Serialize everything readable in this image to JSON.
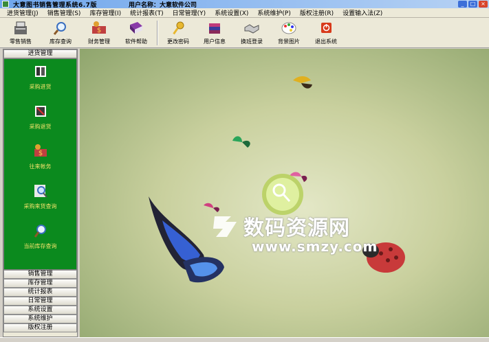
{
  "window": {
    "title": "大意图书销售管理系统6.7版",
    "user_label": "用户名称：大意软件公司",
    "min": "_",
    "max": "□",
    "close": "×"
  },
  "menu": [
    "进货管理(J)",
    "销售管理(S)",
    "库存管理(I)",
    "统计报表(T)",
    "日常管理(Y)",
    "系统设置(X)",
    "系统维护(P)",
    "版权注册(R)",
    "设置输入法(Z)"
  ],
  "toolbar": [
    {
      "label": "零售销售",
      "icon": "cash-register-icon"
    },
    {
      "label": "库存查询",
      "icon": "magnifier-icon"
    },
    {
      "label": "财务管理",
      "icon": "money-icon"
    },
    {
      "label": "软件帮助",
      "icon": "help-book-icon"
    },
    {
      "label": "更改密码",
      "icon": "key-icon"
    },
    {
      "label": "用户信息",
      "icon": "books-icon"
    },
    {
      "label": "换班登录",
      "icon": "handshake-icon"
    },
    {
      "label": "背景图片",
      "icon": "palette-icon"
    },
    {
      "label": "退出系统",
      "icon": "power-icon"
    }
  ],
  "sidebar": {
    "active_section": "进货管理",
    "items": [
      {
        "label": "采购进货",
        "icon": "book-import-icon"
      },
      {
        "label": "采购退货",
        "icon": "book-return-icon"
      },
      {
        "label": "往来帐务",
        "icon": "money-icon"
      },
      {
        "label": "采购来货查询",
        "icon": "magnifier-icon"
      },
      {
        "label": "当前库存查询",
        "icon": "magnifier-icon"
      }
    ],
    "sections": [
      "销售管理",
      "库存管理",
      "统计报表",
      "日常管理",
      "系统设置",
      "系统维护",
      "版权注册"
    ]
  },
  "watermark": {
    "title": "数码资源网",
    "url": "www.smzy.com"
  },
  "colors": {
    "panel": "#0b8a1e",
    "panel_text": "#f0e26a",
    "menu_bg": "#ece9d8"
  }
}
